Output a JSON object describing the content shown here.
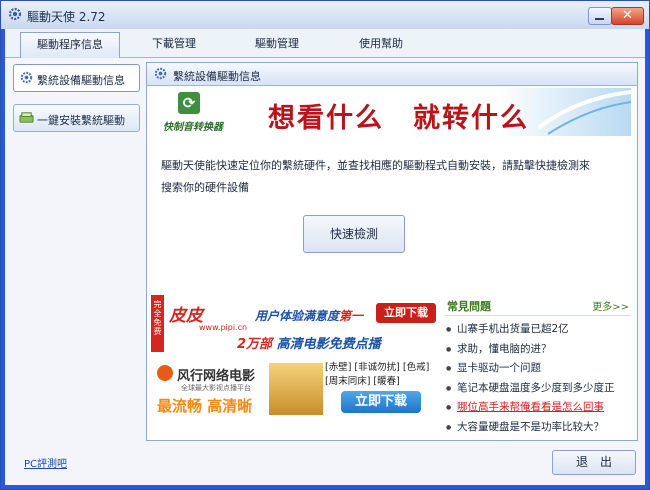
{
  "window": {
    "title": "驅動天使 2.72",
    "close_glyph": "✕"
  },
  "tabs": [
    {
      "label": "驅動程序信息",
      "active": true
    },
    {
      "label": "下載管理",
      "active": false
    },
    {
      "label": "驅動管理",
      "active": false
    },
    {
      "label": "使用幫助",
      "active": false
    }
  ],
  "sidebar": {
    "items": [
      {
        "label": "繫統設備驅動信息",
        "icon": "gear-icon",
        "active": true
      },
      {
        "label": "一鍵安裝繫統驅動",
        "icon": "install-icon",
        "active": false
      }
    ]
  },
  "panel": {
    "title": "繫統設備驅動信息",
    "banner": {
      "logo_text": "快制音转换器",
      "slogan": "想看什么　就转什么"
    },
    "description": [
      "驅動天使能快速定位你的繫統硬件，並查找相應的驅動程式自動安裝，請點擊快捷檢測來",
      "搜索你的硬件設備"
    ],
    "quick_button": "快速檢測"
  },
  "ads": {
    "pipi": {
      "side_text": "完全免费",
      "logo": "皮皮",
      "url": "www.pipi.cn",
      "headline": "用户体验满意度",
      "rank": "第一",
      "download": "立即下载",
      "sub_hl": "2万部",
      "sub_text": "高清电影免费点播"
    },
    "fengxing": {
      "brand": "风行网络电影",
      "tagline": "全球最大影视点播平台",
      "slogan": "最流畅 高清晰",
      "titles": "[赤壁] [非诚勿扰] [色戒] [周末同床] [暖春]",
      "download": "立即下载"
    }
  },
  "faq": {
    "title": "常見問題",
    "more": "更多>>",
    "items": [
      {
        "text": "山寨手机出货量已超2亿",
        "highlight": false
      },
      {
        "text": "求助，懂电脑的进？",
        "highlight": false
      },
      {
        "text": "显卡驱动一个问题",
        "highlight": false
      },
      {
        "text": "笔记本硬盘温度多少度到多少度正",
        "highlight": false
      },
      {
        "text": "哪位高手来帮俺看看是怎么回事",
        "highlight": true
      },
      {
        "text": "大容量硬盘是不是功率比较大？",
        "highlight": false
      }
    ]
  },
  "footer": {
    "link": "PC評測吧",
    "exit_button": "退　出"
  },
  "colors": {
    "frame_blue": "#2a59d8",
    "faq_green": "#3f7a22",
    "highlight_red": "#d42020",
    "banner_red": "#b8141a"
  }
}
